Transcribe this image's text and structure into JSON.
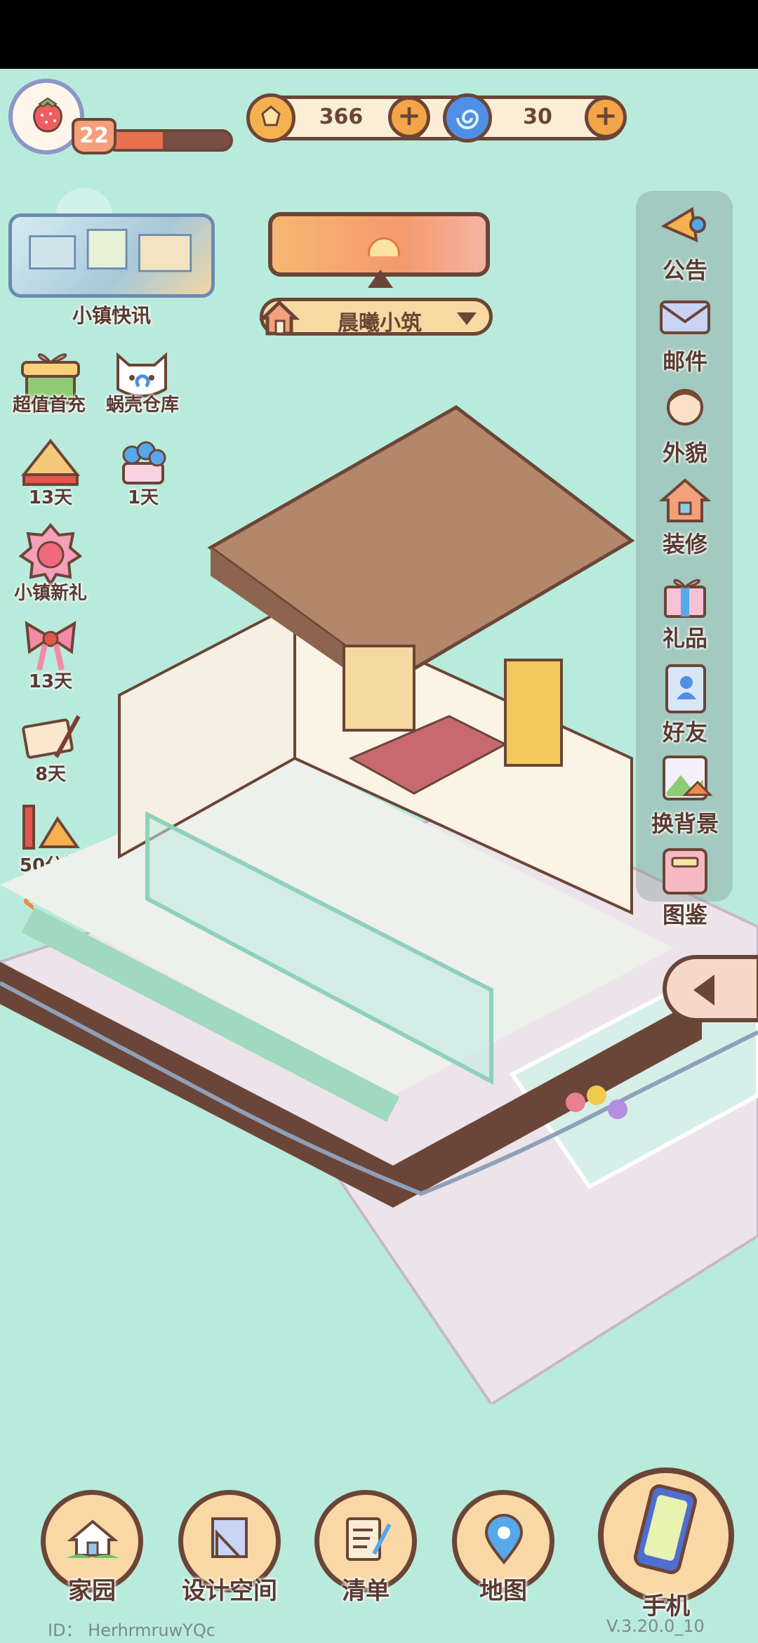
{
  "player": {
    "level": "22",
    "xp_progress": 0.45
  },
  "currency": {
    "coins": "366",
    "shells": "30"
  },
  "left_menu": {
    "news_label": "小镇快讯",
    "items": [
      {
        "label": "超值首充"
      },
      {
        "label": "蜗壳仓库"
      },
      {
        "label": "13天"
      },
      {
        "label": "1天"
      },
      {
        "label": "小镇新礼"
      },
      {
        "label": "13天"
      },
      {
        "label": "8天"
      },
      {
        "label": "50分钟"
      }
    ]
  },
  "house": {
    "name": "晨曦小筑"
  },
  "right_menu": {
    "items": [
      {
        "label": "公告",
        "icon": "megaphone-icon"
      },
      {
        "label": "邮件",
        "icon": "mail-icon"
      },
      {
        "label": "外貌",
        "icon": "avatar-icon"
      },
      {
        "label": "装修",
        "icon": "house-wrench-icon"
      },
      {
        "label": "礼品",
        "icon": "gift-icon"
      },
      {
        "label": "好友",
        "icon": "contact-book-icon"
      },
      {
        "label": "换背景",
        "icon": "landscape-icon"
      },
      {
        "label": "图鉴",
        "icon": "album-icon"
      }
    ]
  },
  "bottom_nav": {
    "items": [
      {
        "label": "家园",
        "icon": "home-icon"
      },
      {
        "label": "设计空间",
        "icon": "blueprint-icon"
      },
      {
        "label": "清单",
        "icon": "list-icon"
      },
      {
        "label": "地图",
        "icon": "map-pin-icon"
      },
      {
        "label": "手机",
        "icon": "phone-icon"
      }
    ]
  },
  "footer": {
    "id_text": "ID：  HerhrmruwYQc",
    "version": "V.3.20.0_10"
  },
  "colors": {
    "background": "#b9ebdc",
    "outline": "#6b4537",
    "accent": "#f4a547"
  }
}
